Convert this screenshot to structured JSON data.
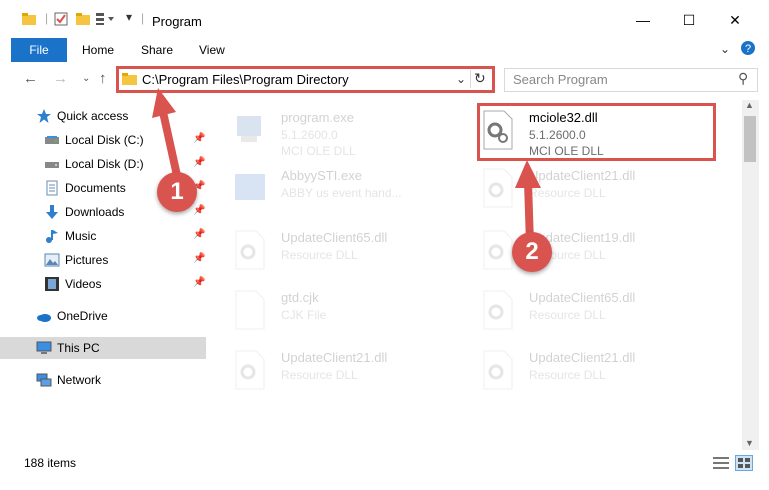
{
  "window": {
    "title": "Program"
  },
  "ribbon": {
    "file": "File",
    "tabs": [
      "Home",
      "Share",
      "View"
    ]
  },
  "address": {
    "path": "C:\\Program Files\\Program Directory"
  },
  "search": {
    "placeholder": "Search Program"
  },
  "sidebar": {
    "items": [
      {
        "label": "Quick access",
        "icon": "star-icon",
        "pinned": false
      },
      {
        "label": "Local Disk (C:)",
        "icon": "drive-icon",
        "pinned": true
      },
      {
        "label": "Local Disk (D:)",
        "icon": "drive-icon",
        "pinned": true
      },
      {
        "label": "Documents",
        "icon": "documents-icon",
        "pinned": true
      },
      {
        "label": "Downloads",
        "icon": "download-icon",
        "pinned": true
      },
      {
        "label": "Music",
        "icon": "music-icon",
        "pinned": true
      },
      {
        "label": "Pictures",
        "icon": "pictures-icon",
        "pinned": true
      },
      {
        "label": "Videos",
        "icon": "videos-icon",
        "pinned": true
      },
      {
        "label": "OneDrive",
        "icon": "cloud-icon",
        "pinned": false
      },
      {
        "label": "This PC",
        "icon": "computer-icon",
        "pinned": false,
        "selected": true
      },
      {
        "label": "Network",
        "icon": "network-icon",
        "pinned": false
      }
    ]
  },
  "files": [
    {
      "name": "program.exe",
      "line2": "5.1.2600.0",
      "line3": "MCI OLE DLL",
      "icon": "exe-icon",
      "highlight": false
    },
    {
      "name": "mciole32.dll",
      "line2": "5.1.2600.0",
      "line3": "MCI OLE DLL",
      "icon": "dll-gear-icon",
      "highlight": true
    },
    {
      "name": "AbbyySTI.exe",
      "line2": "ABBY us event hand...",
      "line3": "",
      "icon": "exe-icon",
      "highlight": false
    },
    {
      "name": "UpdateClient21.dll",
      "line2": "Resource DLL",
      "line3": "",
      "icon": "dll-gear-icon",
      "highlight": false
    },
    {
      "name": "UpdateClient65.dll",
      "line2": "Resource DLL",
      "line3": "",
      "icon": "dll-gear-icon",
      "highlight": false
    },
    {
      "name": "UpdateClient19.dll",
      "line2": "Resource DLL",
      "line3": "",
      "icon": "dll-gear-icon",
      "highlight": false
    },
    {
      "name": "gtd.cjk",
      "line2": "CJK File",
      "line3": "",
      "icon": "file-icon",
      "highlight": false
    },
    {
      "name": "UpdateClient65.dll",
      "line2": "Resource DLL",
      "line3": "",
      "icon": "dll-gear-icon",
      "highlight": false
    },
    {
      "name": "UpdateClient21.dll",
      "line2": "Resource DLL",
      "line3": "",
      "icon": "dll-gear-icon",
      "highlight": false
    },
    {
      "name": "UpdateClient21.dll",
      "line2": "Resource DLL",
      "line3": "",
      "icon": "dll-gear-icon",
      "highlight": false
    }
  ],
  "status": {
    "count": "188 items"
  },
  "callouts": [
    "1",
    "2"
  ],
  "colors": {
    "accent": "#1a73c8",
    "highlight": "#d9534f"
  }
}
